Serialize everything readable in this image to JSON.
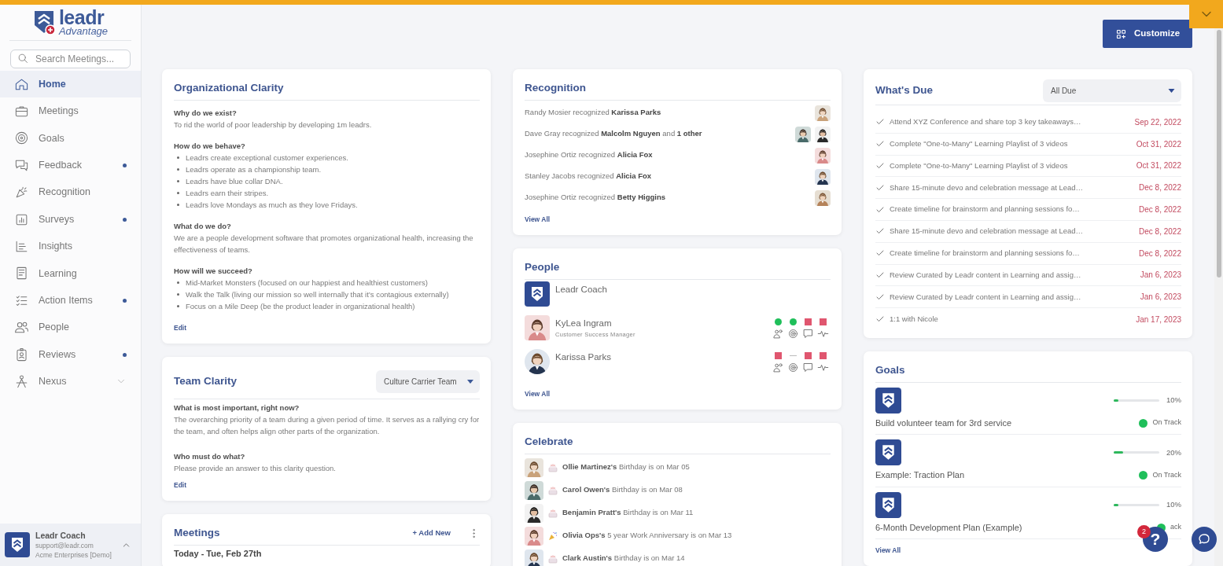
{
  "sidebar": {
    "logo": {
      "wordmark": "leadr",
      "tagline": "Advantage"
    },
    "search": {
      "placeholder": "Search Meetings..."
    },
    "items": [
      {
        "label": "Home",
        "selected": true,
        "notification": false
      },
      {
        "label": "Meetings",
        "selected": false,
        "notification": false
      },
      {
        "label": "Goals",
        "selected": false,
        "notification": false
      },
      {
        "label": "Feedback",
        "selected": false,
        "notification": true
      },
      {
        "label": "Recognition",
        "selected": false,
        "notification": false
      },
      {
        "label": "Surveys",
        "selected": false,
        "notification": true
      },
      {
        "label": "Insights",
        "selected": false,
        "notification": false
      },
      {
        "label": "Learning",
        "selected": false,
        "notification": false
      },
      {
        "label": "Action Items",
        "selected": false,
        "notification": true
      },
      {
        "label": "People",
        "selected": false,
        "notification": false
      },
      {
        "label": "Reviews",
        "selected": false,
        "notification": true
      },
      {
        "label": "Nexus",
        "selected": false,
        "notification": false,
        "kind": "group",
        "expanded": false
      }
    ],
    "user": {
      "name": "Leadr Coach",
      "email": "support@leadr.com",
      "org": "Acme Enterprises [Demo]",
      "expanded": false
    }
  },
  "customize": {
    "label": "Customize"
  },
  "org_clarity": {
    "title": "Organizational Clarity",
    "sections": [
      {
        "question": "Why do we exist?",
        "answer": "To rid the world of poor leadership by developing 1m leadrs."
      },
      {
        "question": "How do we behave?",
        "bullets": [
          "Leadrs create exceptional customer experiences.",
          "Leadrs operate as a championship team.",
          "Leadrs have blue collar DNA.",
          "Leadrs earn their stripes.",
          "Leadrs love Mondays as much as they love Fridays."
        ]
      },
      {
        "question": "What do we do?",
        "answer": "We are a people development software that promotes organizational health, increasing the effectiveness of teams."
      },
      {
        "question": "How will we succeed?",
        "bullets": [
          "Mid-Market Monsters (focused on our happiest and healthiest customers)",
          "Walk the Talk (living our mission so well internally that it’s contagious externally)",
          "Focus on a Mile Deep (be the product leader in organizational health)"
        ]
      }
    ],
    "edit": "Edit"
  },
  "team_clarity": {
    "title": "Team Clarity",
    "team": "Culture Carrier Team",
    "sections": [
      {
        "question": "What is most important, right now?",
        "answer": "The overarching priority of a team during a given period of time. It serves as a rallying cry for the team, and often helps align other parts of the organization."
      },
      {
        "question": "Who must do what?",
        "answer": "Please provide an answer to this clarity question."
      }
    ],
    "edit": "Edit"
  },
  "meetings": {
    "title": "Meetings",
    "add_new": "+ Add New",
    "date_heading": "Today - Tue, Feb 27th"
  },
  "recognition": {
    "title": "Recognition",
    "items": [
      {
        "text": "Randy Mosier recognized **Karissa Parks**",
        "avatars": [
          {
            "kind": "picture"
          }
        ]
      },
      {
        "text": "Dave Gray recognized **Malcolm Nguyen** and **1 other**",
        "avatars": [
          {
            "kind": "picture"
          },
          {
            "kind": "picture"
          }
        ]
      },
      {
        "text": "Josephine Ortiz recognized **Alicia Fox**",
        "avatars": [
          {
            "kind": "picture"
          }
        ]
      },
      {
        "text": "Stanley Jacobs recognized **Alicia Fox**",
        "avatars": [
          {
            "kind": "picture"
          }
        ]
      },
      {
        "text": "Josephine Ortiz recognized **Betty Higgins**",
        "avatars": [
          {
            "kind": "picture"
          }
        ]
      }
    ],
    "view_all": "View All"
  },
  "people": {
    "title": "People",
    "items": [
      {
        "name": "Leadr Coach",
        "avatar": {
          "kind": "logo"
        }
      },
      {
        "name": "KyLea Ingram",
        "role": "Customer Success Manager",
        "avatar": {
          "kind": "picture"
        },
        "indicators": [
          {
            "kind": "dot",
            "color": "#1fbf5a"
          },
          {
            "kind": "dot",
            "color": "#1fbf5a"
          },
          {
            "kind": "square",
            "color": "#e0566f"
          },
          {
            "kind": "square",
            "color": "#e0566f"
          }
        ]
      },
      {
        "name": "Karissa Parks",
        "avatar": {
          "kind": "picture"
        },
        "indicators": [
          {
            "kind": "square",
            "color": "#e0566f"
          },
          {
            "kind": "dash"
          },
          {
            "kind": "square",
            "color": "#e0566f"
          },
          {
            "kind": "square",
            "color": "#e0566f"
          }
        ]
      }
    ],
    "view_all": "View All"
  },
  "celebrate": {
    "title": "Celebrate",
    "items": [
      {
        "kind": "birthday",
        "text": "**Ollie Martinez's** Birthday is on Mar 05"
      },
      {
        "kind": "birthday",
        "text": "**Carol Owen's** Birthday is on Mar 08"
      },
      {
        "kind": "birthday",
        "text": "**Benjamin Pratt's** Birthday is on Mar 11"
      },
      {
        "kind": "anniversary",
        "text": "**Olivia Ops's** 5 year Work Anniversary is on Mar 13"
      },
      {
        "kind": "birthday",
        "text": "**Clark Austin's** Birthday is on Mar 14"
      }
    ]
  },
  "whats_due": {
    "title": "What's Due",
    "filter": "All Due",
    "items": [
      {
        "text": "Attend XYZ Conference and share top 3 key takeaways…",
        "date": "Sep 22, 2022"
      },
      {
        "text": "Complete \"One-to-Many\" Learning Playlist of 3 videos",
        "date": "Oct 31, 2022"
      },
      {
        "text": "Complete \"One-to-Many\" Learning Playlist of 3 videos",
        "date": "Oct 31, 2022"
      },
      {
        "text": "Share 15-minute devo and celebration message at Lead…",
        "date": "Dec 8, 2022"
      },
      {
        "text": "Create timeline for brainstorm and planning sessions fo…",
        "date": "Dec 8, 2022"
      },
      {
        "text": "Share 15-minute devo and celebration message at Lead…",
        "date": "Dec 8, 2022"
      },
      {
        "text": "Create timeline for brainstorm and planning sessions fo…",
        "date": "Dec 8, 2022"
      },
      {
        "text": "Review Curated by Leadr content in Learning and assig…",
        "date": "Jan 6, 2023"
      },
      {
        "text": "Review Curated by Leadr content in Learning and assig…",
        "date": "Jan 6, 2023"
      },
      {
        "text": "1:1 with Nicole",
        "date": "Jan 17, 2023"
      }
    ]
  },
  "goals": {
    "title": "Goals",
    "items": [
      {
        "title": "Build volunteer team for 3rd service",
        "level": 0.1,
        "percent": "10%",
        "status": "On Track"
      },
      {
        "title": "Example: Traction Plan",
        "level": 0.2,
        "percent": "20%",
        "status": "On Track"
      },
      {
        "title": "6-Month Development Plan (Example)",
        "level": 0.1,
        "percent": "10%",
        "status": "ack"
      }
    ],
    "view_all": "View All"
  },
  "help": {
    "label": "?",
    "badge": "2"
  }
}
